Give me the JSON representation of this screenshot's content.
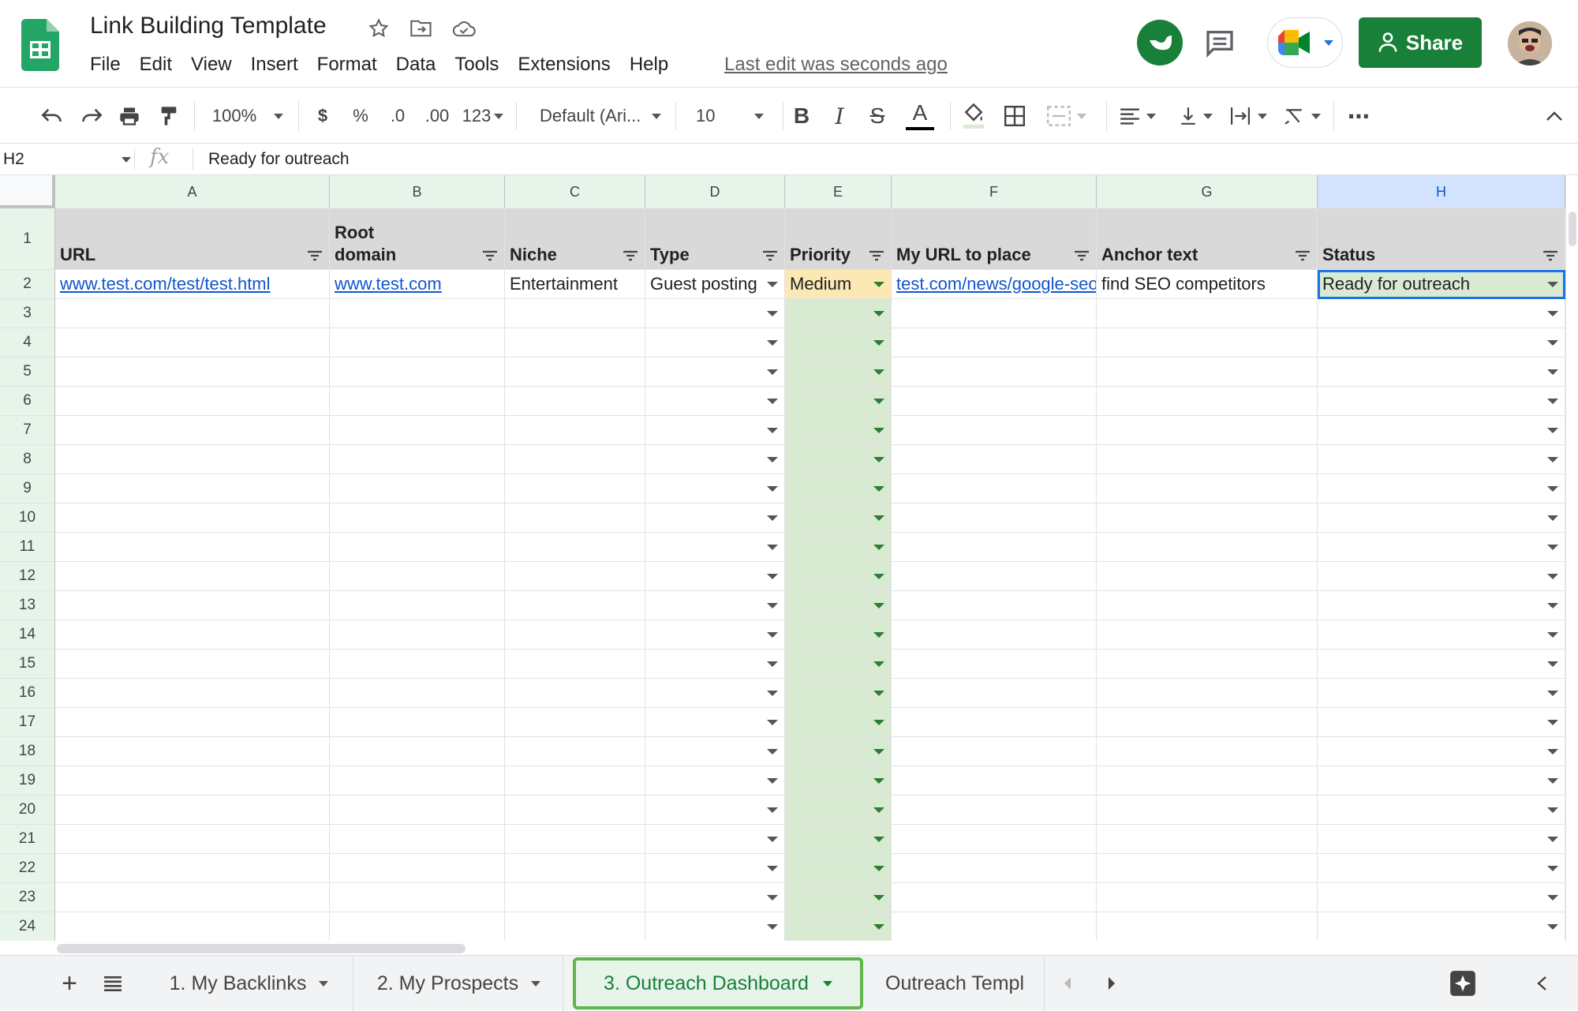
{
  "header": {
    "title": "Link Building Template",
    "menu": [
      "File",
      "Edit",
      "View",
      "Insert",
      "Format",
      "Data",
      "Tools",
      "Extensions",
      "Help"
    ],
    "last_edit": "Last edit was seconds ago",
    "share_label": "Share"
  },
  "toolbar": {
    "zoom": "100%",
    "currency": "$",
    "percent": "%",
    "decrease_decimal": ".0",
    "increase_decimal": ".00",
    "number_format": "123",
    "font": "Default (Ari...",
    "font_size": "10",
    "more": "⋯"
  },
  "formula_bar": {
    "cell_ref": "H2",
    "value": "Ready for outreach"
  },
  "columns": [
    "A",
    "B",
    "C",
    "D",
    "E",
    "F",
    "G",
    "H"
  ],
  "header_row": [
    "URL",
    "Root domain",
    "Niche",
    "Type",
    "Priority",
    "My URL to place",
    "Anchor text",
    "Status"
  ],
  "data_row": {
    "url": "www.test.com/test/test.html",
    "root_domain": "www.test.com",
    "niche": "Entertainment",
    "type": "Guest posting",
    "priority": "Medium",
    "my_url": "test.com/news/google-seo",
    "anchor_text": "find SEO competitors",
    "status": "Ready for outreach"
  },
  "row_numbers": [
    "1",
    "2",
    "3",
    "4",
    "5",
    "6",
    "7",
    "8",
    "9",
    "10",
    "11",
    "12",
    "13",
    "14",
    "15",
    "16",
    "17",
    "18",
    "19",
    "20",
    "21",
    "22",
    "23",
    "24"
  ],
  "sheet_tabs": [
    "1. My Backlinks",
    "2. My Prospects",
    "3. Outreach Dashboard",
    "Outreach Templ"
  ],
  "active_tab": "3. Outreach Dashboard",
  "colors": {
    "accent_green": "#188038",
    "selection_blue": "#1a73e8",
    "priority_fill": "#d9ead3",
    "medium_fill": "#fce8b2"
  }
}
